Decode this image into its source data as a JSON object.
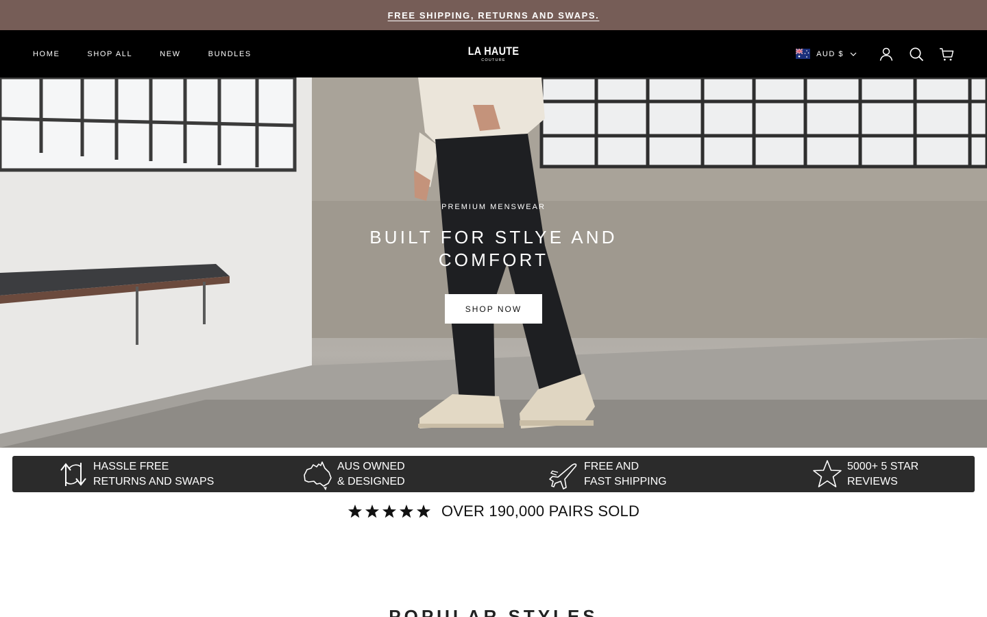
{
  "announcement": {
    "text": "FREE SHIPPING, RETURNS AND SWAPS."
  },
  "header": {
    "nav": [
      "HOME",
      "SHOP ALL",
      "NEW",
      "BUNDLES"
    ],
    "logo": {
      "main": "LA HAUTE",
      "sub": "COUTURE"
    },
    "currency": "AUD $",
    "icons": [
      "account-icon",
      "search-icon",
      "cart-icon"
    ]
  },
  "hero": {
    "eyebrow": "PREMIUM MENSWEAR",
    "headline": "BUILT FOR STLYE AND COMFORT",
    "button": "SHOP NOW"
  },
  "usp": [
    {
      "icon": "returns-arrows-icon",
      "line1": "HASSLE FREE",
      "line2": "RETURNS AND SWAPS"
    },
    {
      "icon": "australia-map-icon",
      "line1": "AUS OWNED",
      "line2": "& DESIGNED"
    },
    {
      "icon": "airplane-icon",
      "line1": "FREE AND",
      "line2": "FAST SHIPPING"
    },
    {
      "icon": "star-outline-icon",
      "line1": "5000+ 5 STAR",
      "line2": "REVIEWS"
    }
  ],
  "rating": {
    "stars": 5,
    "text": "OVER 190,000 PAIRS SOLD"
  },
  "section": {
    "title": "POPULAR STYLES"
  },
  "colors": {
    "announcement_bg": "#765d57",
    "header_bg": "#000000",
    "usp_bg": "#2b2b2b"
  }
}
